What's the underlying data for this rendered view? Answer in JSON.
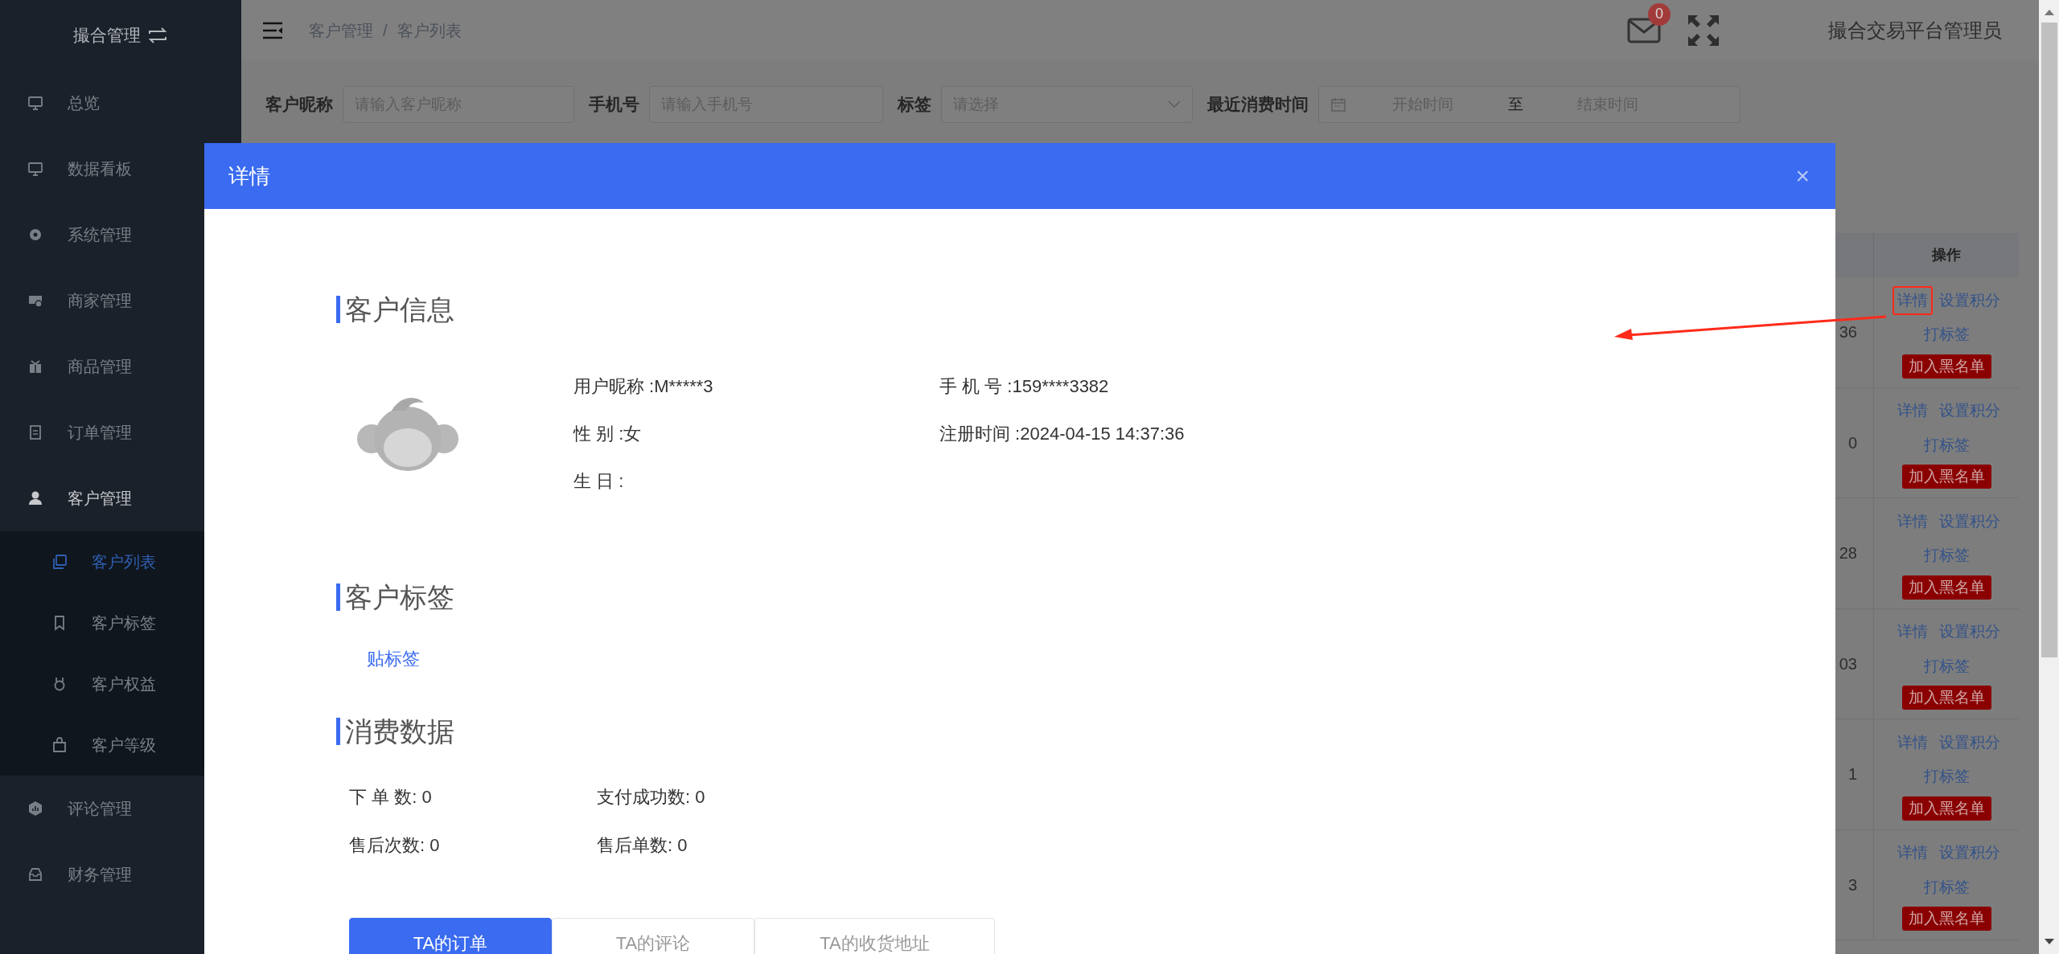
{
  "sidebar": {
    "title": "撮合管理",
    "items": [
      {
        "label": "总览",
        "expanded": false,
        "selected": false
      },
      {
        "label": "数据看板",
        "expanded": false,
        "selected": false
      },
      {
        "label": "系统管理",
        "expanded": false,
        "selected": false
      },
      {
        "label": "商家管理",
        "expanded": false,
        "selected": false
      },
      {
        "label": "商品管理",
        "expanded": false,
        "selected": false
      },
      {
        "label": "订单管理",
        "expanded": false,
        "selected": false
      },
      {
        "label": "客户管理",
        "expanded": true,
        "selected": false,
        "children": [
          {
            "label": "客户列表",
            "selected": true
          },
          {
            "label": "客户标签",
            "selected": false
          },
          {
            "label": "客户权益",
            "selected": false
          },
          {
            "label": "客户等级",
            "selected": false
          }
        ]
      },
      {
        "label": "评论管理",
        "expanded": false,
        "selected": false
      },
      {
        "label": "财务管理",
        "expanded": false,
        "selected": false
      }
    ]
  },
  "breadcrumb": [
    "客户管理",
    "/",
    "客户列表"
  ],
  "header": {
    "mail_count": "0",
    "user_name": "撮合交易平台管理员"
  },
  "filters": [
    {
      "label": "客户昵称",
      "kind": "input",
      "placeholder": "请输入客户昵称"
    },
    {
      "label": "手机号",
      "kind": "input",
      "placeholder": "请输入手机号"
    },
    {
      "label": "标签",
      "kind": "select",
      "placeholder": "请选择"
    },
    {
      "label": "最近消费时间",
      "kind": "daterange",
      "start_placeholder": "开始时间",
      "separator": "至",
      "end_placeholder": "结束时间"
    }
  ],
  "table": {
    "columns": [
      "操作"
    ],
    "rows": [
      {
        "column_partial": "36",
        "detail": "详情",
        "points": "设置积分",
        "tag": "打标签",
        "blacklist": "加入黑名单",
        "highlighted": true
      },
      {
        "column_partial": "0",
        "detail": "详情",
        "points": "设置积分",
        "tag": "打标签",
        "blacklist": "加入黑名单",
        "highlighted": false
      },
      {
        "column_partial": "28",
        "detail": "详情",
        "points": "设置积分",
        "tag": "打标签",
        "blacklist": "加入黑名单",
        "highlighted": false
      },
      {
        "column_partial": "03",
        "detail": "详情",
        "points": "设置积分",
        "tag": "打标签",
        "blacklist": "加入黑名单",
        "highlighted": false
      },
      {
        "column_partial": "1",
        "detail": "详情",
        "points": "设置积分",
        "tag": "打标签",
        "blacklist": "加入黑名单",
        "highlighted": false
      },
      {
        "column_partial": "3",
        "detail": "详情",
        "points": "设置积分",
        "tag": "打标签",
        "blacklist": "加入黑名单",
        "highlighted": false
      }
    ]
  },
  "modal": {
    "title": "详情",
    "close": "×",
    "sections": [
      {
        "title": "客户信息"
      },
      {
        "title": "客户标签"
      },
      {
        "title": "消费数据"
      }
    ],
    "info": [
      [
        "用户昵称 :M*****3",
        "手 机 号 :159****3382"
      ],
      [
        "性 别 :女",
        "注册时间 :2024-04-15 14:37:36"
      ],
      [
        "生 日 :"
      ]
    ],
    "tag_link": "贴标签",
    "stats": [
      [
        "下 单 数: 0",
        "支付成功数: 0"
      ],
      [
        "售后次数: 0",
        "售后单数: 0"
      ]
    ],
    "tabs": [
      {
        "label": "TA的订单",
        "selected": true
      },
      {
        "label": "TA的评论",
        "selected": false
      },
      {
        "label": "TA的收货地址",
        "selected": false
      }
    ]
  }
}
